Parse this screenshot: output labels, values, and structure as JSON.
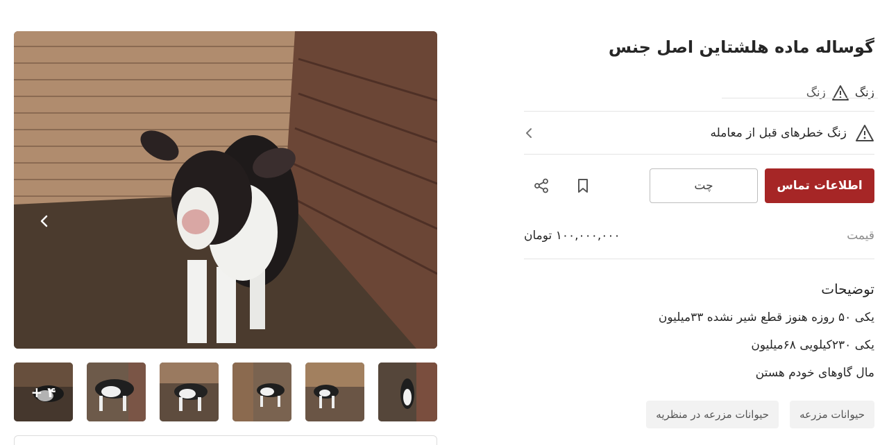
{
  "listing": {
    "title": "گوساله ماده هلشتاین اصل جنس",
    "alarm_tag_primary": "زنگ",
    "alarm_tag_secondary": "زنگ",
    "risk_notice": "زنگ خطرهای قبل از معامله",
    "contact_button": "اطلاعات تماس",
    "chat_button": "چت",
    "price_label": "قیمت",
    "price_value": "۱۰۰,۰۰۰,۰۰۰ تومان",
    "description_title": "توضیحات",
    "description_lines": [
      "یکی ۵۰ روزه هنوز قطع شیر نشده ۳۳میلیون",
      "یکی ۲۳۰کیلویی ۶۸میلیون",
      "مال گاوهای خودم هستن"
    ],
    "tags": [
      "حیوانات مزرعه",
      "حیوانات مزرعه در منظریه"
    ]
  },
  "gallery": {
    "more_count": "+ ۴",
    "thumbnail_count": 6
  },
  "icons": {
    "prev": "chevron-left-icon",
    "next": "chevron-left-icon",
    "warning": "warning-triangle-icon",
    "bookmark": "bookmark-icon",
    "share": "share-icon"
  },
  "colors": {
    "primary": "#a62626",
    "text": "#262626",
    "muted": "#8c8c8c",
    "chip_bg": "#f2f2f2"
  }
}
